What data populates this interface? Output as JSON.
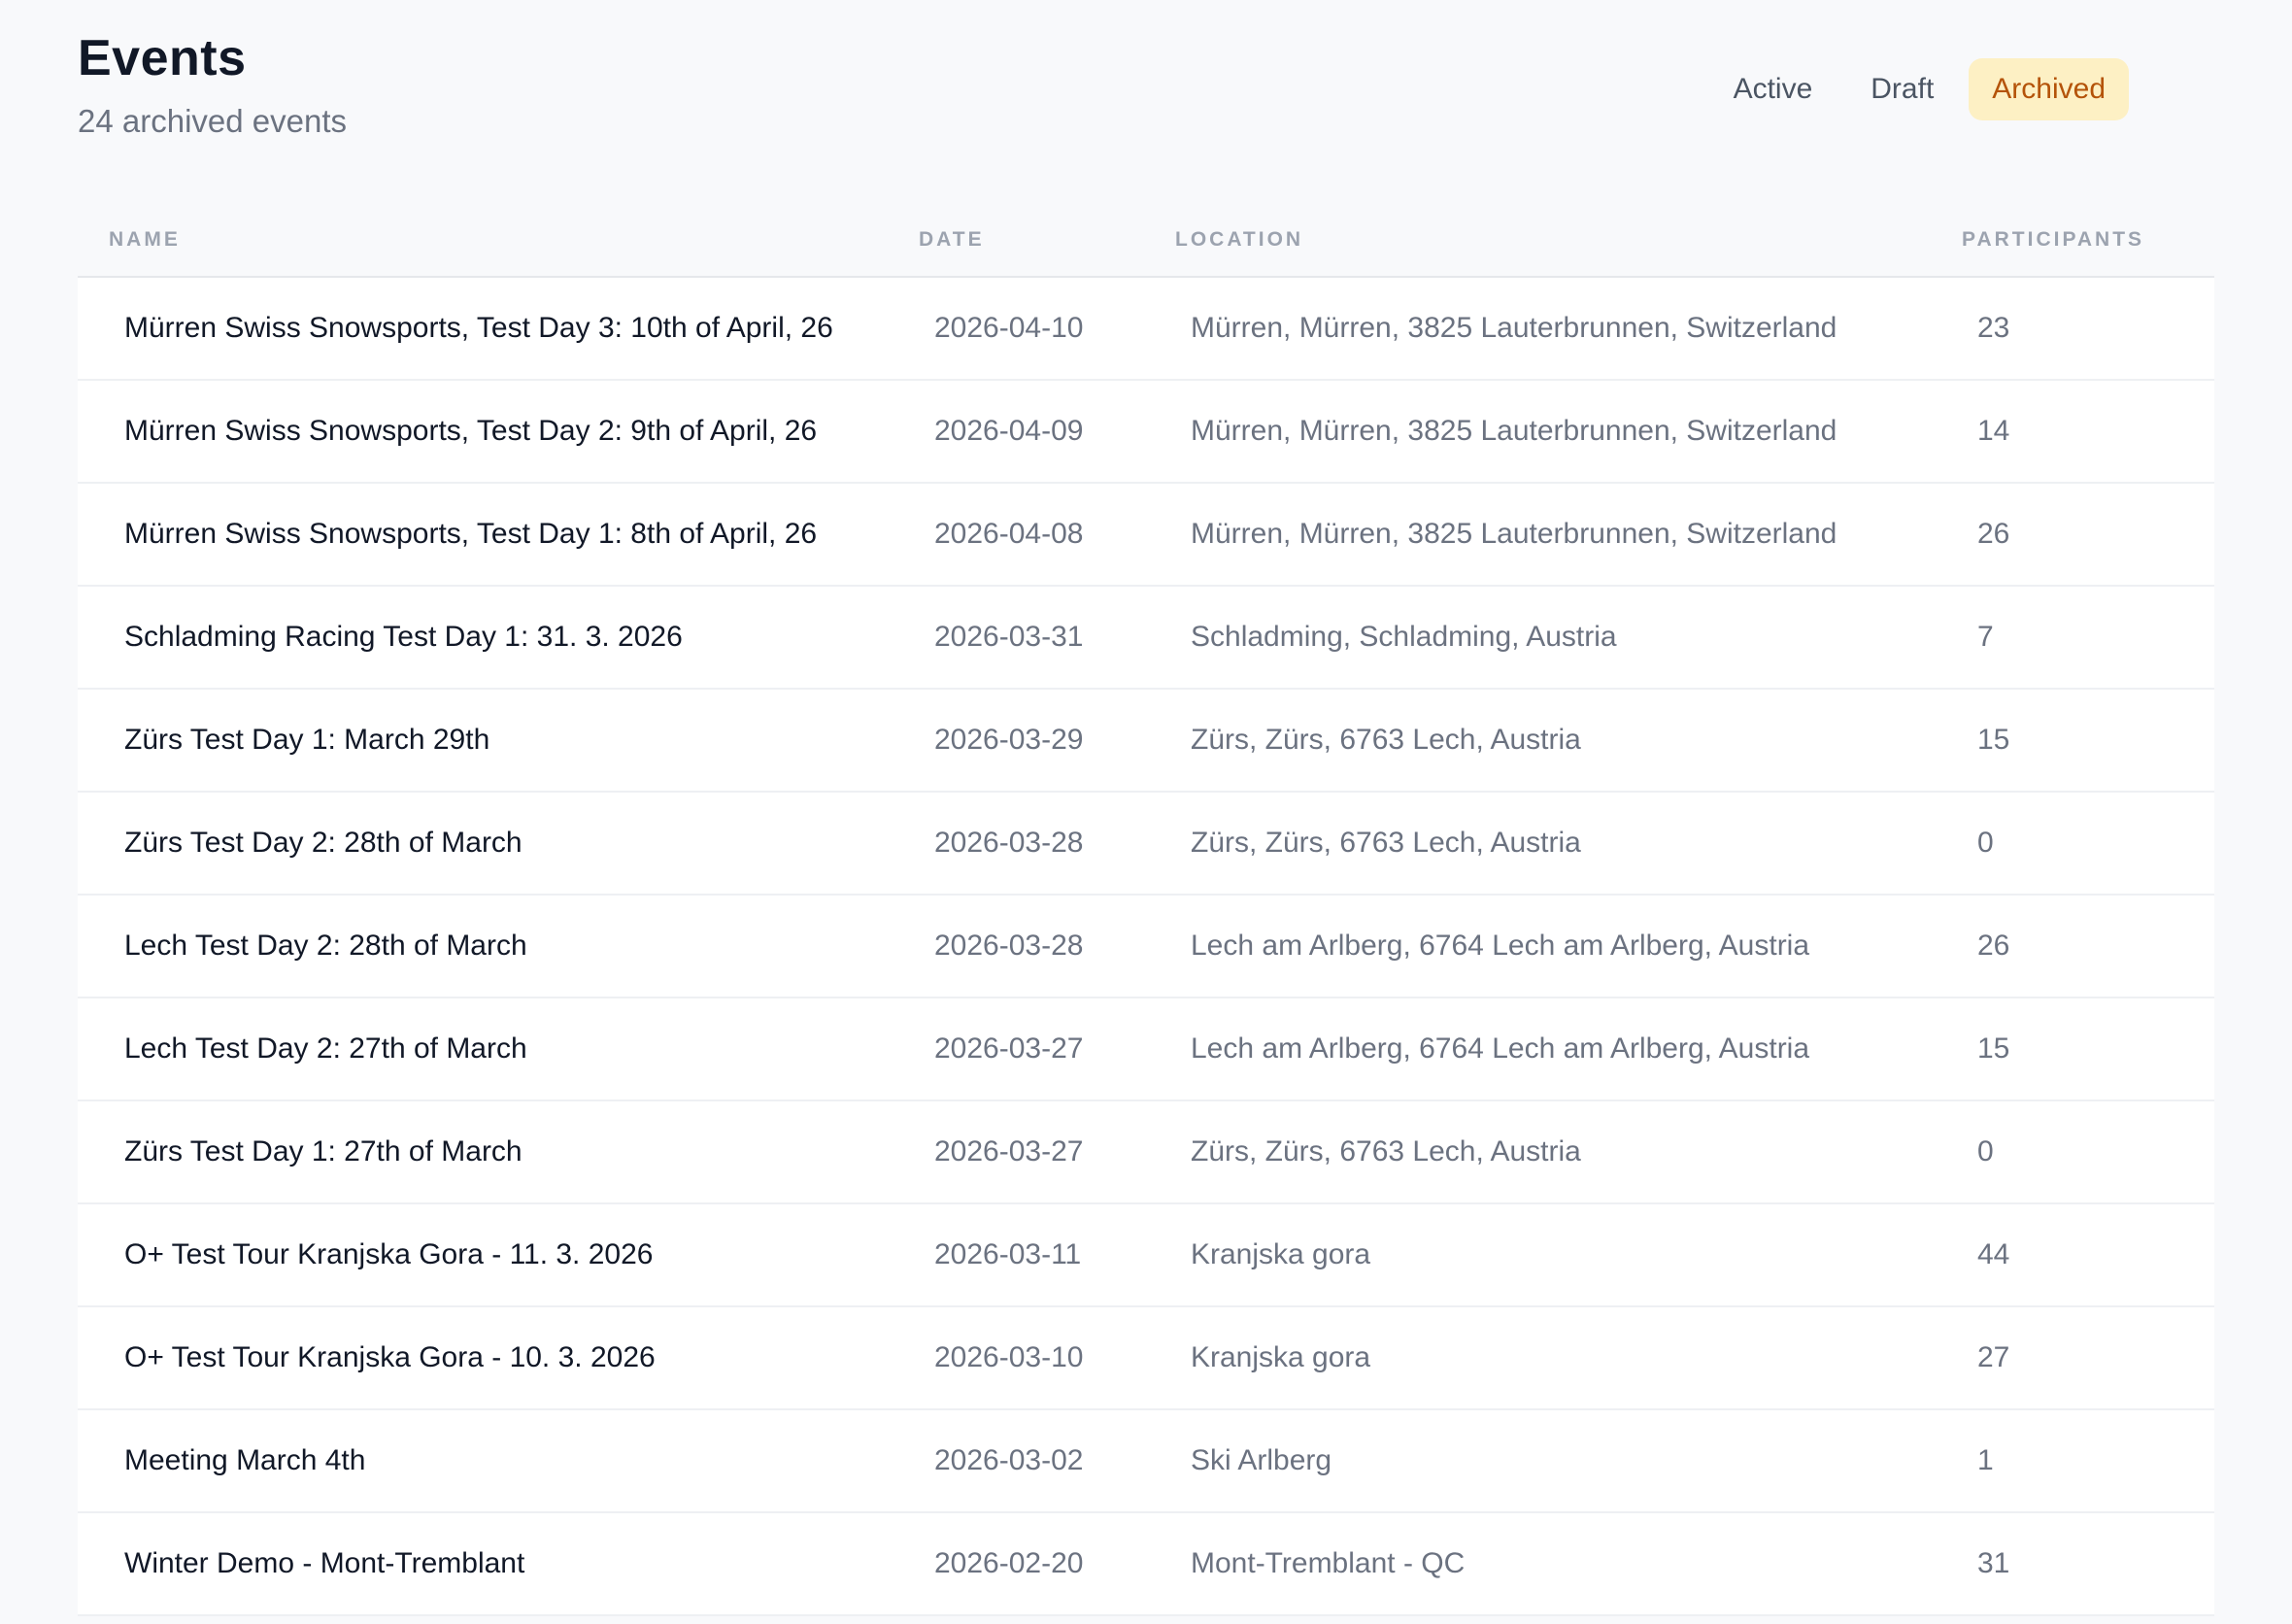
{
  "header": {
    "title": "Events",
    "subtitle": "24 archived events"
  },
  "tabs": [
    {
      "label": "Active",
      "active": false
    },
    {
      "label": "Draft",
      "active": false
    },
    {
      "label": "Archived",
      "active": true
    }
  ],
  "colors": {
    "accent_bg": "#fdf0c4",
    "accent_text": "#b45309"
  },
  "table": {
    "columns": {
      "name": "Name",
      "date": "Date",
      "location": "Location",
      "participants": "Participants"
    },
    "rows": [
      {
        "name": "Mürren Swiss Snowsports, Test Day 3: 10th of April, 26",
        "date": "2026-04-10",
        "location": "Mürren, Mürren, 3825 Lauterbrunnen, Switzerland",
        "participants": "23"
      },
      {
        "name": "Mürren Swiss Snowsports, Test Day 2: 9th of April, 26",
        "date": "2026-04-09",
        "location": "Mürren, Mürren, 3825 Lauterbrunnen, Switzerland",
        "participants": "14"
      },
      {
        "name": "Mürren Swiss Snowsports, Test Day 1: 8th of April, 26",
        "date": "2026-04-08",
        "location": "Mürren, Mürren, 3825 Lauterbrunnen, Switzerland",
        "participants": "26"
      },
      {
        "name": "Schladming Racing Test Day 1: 31. 3. 2026",
        "date": "2026-03-31",
        "location": "Schladming, Schladming, Austria",
        "participants": "7"
      },
      {
        "name": "Zürs Test Day 1: March 29th",
        "date": "2026-03-29",
        "location": "Zürs, Zürs, 6763 Lech, Austria",
        "participants": "15"
      },
      {
        "name": "Zürs Test Day 2: 28th of March",
        "date": "2026-03-28",
        "location": "Zürs, Zürs, 6763 Lech, Austria",
        "participants": "0"
      },
      {
        "name": "Lech Test Day 2: 28th of March",
        "date": "2026-03-28",
        "location": "Lech am Arlberg, 6764 Lech am Arlberg, Austria",
        "participants": "26"
      },
      {
        "name": "Lech Test Day 2: 27th of March",
        "date": "2026-03-27",
        "location": "Lech am Arlberg, 6764 Lech am Arlberg, Austria",
        "participants": "15"
      },
      {
        "name": "Zürs Test Day 1: 27th of March",
        "date": "2026-03-27",
        "location": "Zürs, Zürs, 6763 Lech, Austria",
        "participants": "0"
      },
      {
        "name": "O+ Test Tour Kranjska Gora - 11. 3. 2026",
        "date": "2026-03-11",
        "location": "Kranjska gora",
        "participants": "44"
      },
      {
        "name": "O+ Test Tour Kranjska Gora - 10. 3. 2026",
        "date": "2026-03-10",
        "location": "Kranjska gora",
        "participants": "27"
      },
      {
        "name": "Meeting March 4th",
        "date": "2026-03-02",
        "location": "Ski Arlberg",
        "participants": "1"
      },
      {
        "name": "Winter Demo - Mont-Tremblant",
        "date": "2026-02-20",
        "location": "Mont-Tremblant - QC",
        "participants": "31"
      }
    ]
  }
}
